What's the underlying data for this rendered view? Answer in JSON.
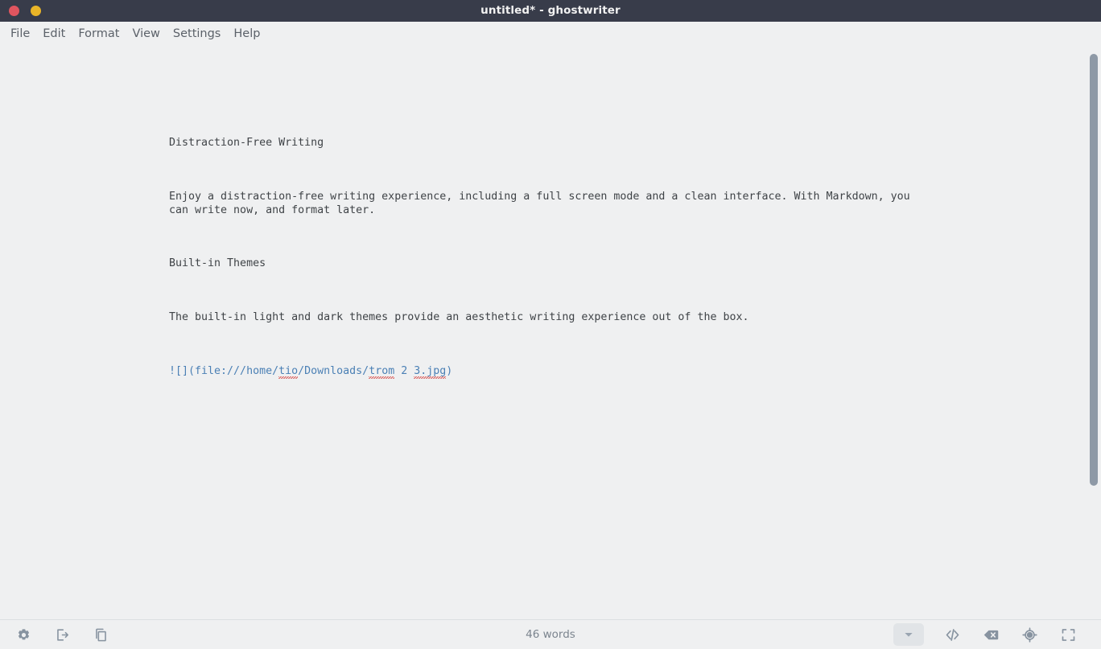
{
  "window": {
    "title": "untitled* - ghostwriter",
    "controls": [
      {
        "name": "close",
        "color": "#e0555f"
      },
      {
        "name": "minimize",
        "color": "#e9b528"
      }
    ]
  },
  "menubar": {
    "items": [
      {
        "label": "File"
      },
      {
        "label": "Edit"
      },
      {
        "label": "Format"
      },
      {
        "label": "View"
      },
      {
        "label": "Settings"
      },
      {
        "label": "Help"
      }
    ]
  },
  "document": {
    "blocks": [
      {
        "id": "heading1",
        "text": "Distraction-Free Writing"
      },
      {
        "id": "para1",
        "text": "Enjoy a distraction-free writing experience, including a full screen mode and a clean interface. With Markdown, you can write now, and format later."
      },
      {
        "id": "heading2",
        "text": "Built-in Themes"
      },
      {
        "id": "para2",
        "text": "The built-in light and dark themes provide an aesthetic writing experience out of the box."
      }
    ],
    "link_line": {
      "prefix": "![](file:///home/",
      "misspelled_1": "tio",
      "mid_1": "/Downloads/",
      "misspelled_2": "trom",
      "mid_2": " 2 ",
      "misspelled_3": "3.jpg",
      "suffix": ")",
      "full_text": "![](file:///home/tio/Downloads/trom 2 3.jpg)",
      "color": "#4b80b5"
    }
  },
  "statusbar": {
    "word_count": "46 words",
    "left_buttons": [
      {
        "name": "settings-gear",
        "tooltip": "Settings"
      },
      {
        "name": "outline-export",
        "tooltip": "Outline"
      },
      {
        "name": "documents-copy",
        "tooltip": "Session Statistics"
      }
    ],
    "right_buttons": [
      {
        "name": "chevron-down",
        "tooltip": "Hemingway Mode",
        "pressed": true
      },
      {
        "name": "code-brackets",
        "tooltip": "HTML Preview"
      },
      {
        "name": "backspace-delete",
        "tooltip": "Clear"
      },
      {
        "name": "focus-crosshair",
        "tooltip": "Focus Mode"
      },
      {
        "name": "fullscreen-expand",
        "tooltip": "Full Screen"
      }
    ]
  },
  "scrollbar": {
    "orientation": "vertical",
    "thumb_position_pct": 0,
    "thumb_size_pct": 72
  },
  "colors": {
    "titlebar_bg": "#383c4a",
    "app_bg": "#eff0f1",
    "text": "#3f4347",
    "menu_text": "#5b6169",
    "link": "#4b80b5",
    "icon": "#8793a0",
    "scrollbar_thumb": "#8e99a6",
    "spellcheck_underline": "#d9534f"
  }
}
